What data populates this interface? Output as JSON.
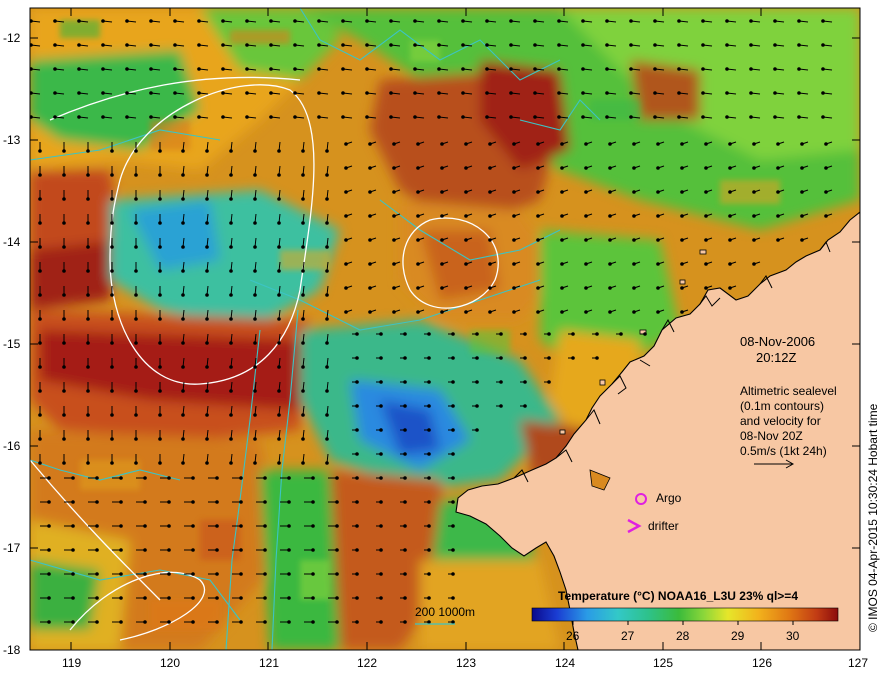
{
  "map": {
    "lon_ticks": [
      "119",
      "120",
      "121",
      "122",
      "123",
      "124",
      "125",
      "126",
      "127"
    ],
    "lat_ticks": [
      "-12",
      "-13",
      "-14",
      "-15",
      "-16",
      "-17",
      "-18"
    ],
    "lon_range": [
      118.6,
      127.0
    ],
    "lat_range": [
      -18.0,
      -11.7
    ]
  },
  "annotation": {
    "date": "08-Nov-2006",
    "time": "20:12Z",
    "legend_lines": [
      "Altimetric sealevel",
      "(0.1m contours)",
      "and velocity for",
      "08-Nov 20Z",
      "0.5m/s (1kt 24h)"
    ],
    "argo_label": "Argo",
    "drifter_label": "drifter",
    "depth_label": "200  1000m"
  },
  "colorbar": {
    "title": "Temperature (°C) NOAA16_L3U 23% ql>=4",
    "ticks": [
      "26",
      "27",
      "28",
      "29",
      "30"
    ]
  },
  "credit": "© IMOS 04-Apr-2015 10:30:24 Hobart time",
  "colors": {
    "land": "#f7c7a3",
    "contour": "#ffffff",
    "bathymetry": "#3cc4c4",
    "argo": "#e020e0"
  }
}
